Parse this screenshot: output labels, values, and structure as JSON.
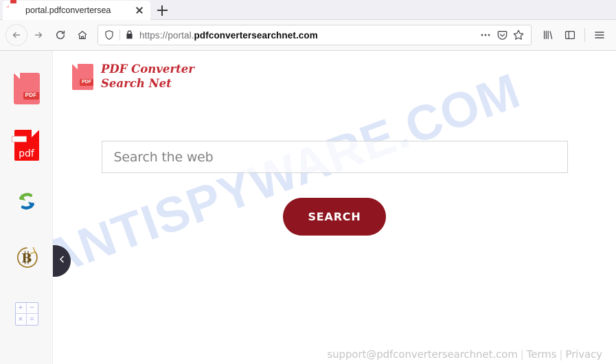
{
  "browser": {
    "tab": {
      "title": "portal.pdfconvertersea",
      "favicon": "pdf-document-icon",
      "close_label": "×"
    },
    "new_tab_label": "+",
    "nav": {
      "back": "back-arrow",
      "forward": "forward-arrow",
      "reload": "reload-arrow",
      "home": "home-house"
    },
    "urlbar": {
      "shield": "tracking-protection-shield",
      "lock": "padlock-secure",
      "url_prefix": "https://portal.",
      "url_domain": "pdfconvertersearchnet.com",
      "full_url": "https://portal.pdfconvertersearchnet.com",
      "page_actions": "ellipsis-menu",
      "pocket": "pocket-save",
      "bookmark": "bookmark-star"
    },
    "toolbar": {
      "library": "library-books",
      "sidebar": "sidebar-panel",
      "menu": "hamburger-menu"
    }
  },
  "page": {
    "watermark": "MYANTISPYWARE.COM",
    "brand": {
      "line1": "PDF Converter",
      "line2": "Search Net",
      "mark_label": "PDF"
    },
    "rail": {
      "items": [
        {
          "name": "pdf-document",
          "label": "PDF"
        },
        {
          "name": "pdf-file",
          "label": "pdf"
        },
        {
          "name": "convert-arrows",
          "label": ""
        },
        {
          "name": "bitcoin",
          "label": "B"
        },
        {
          "name": "calculator",
          "keys": [
            "+",
            "−",
            "×",
            "="
          ]
        }
      ]
    },
    "collapse_handle": "chevron-left-icon",
    "search": {
      "placeholder": "Search the web",
      "value": "",
      "button_label": "SEARCH"
    },
    "footer": {
      "email": "support@pdfconvertersearchnet.com",
      "separator": "|",
      "terms": "Terms",
      "privacy": "Privacy"
    }
  },
  "colors": {
    "brand_red": "#c32a33",
    "button_red": "#8f1620",
    "pdf_light": "#f4727c",
    "pdf_bright": "#f50d0d",
    "watermark_blue": "#c9d7f5",
    "rail_bg": "#f7f7f7"
  }
}
